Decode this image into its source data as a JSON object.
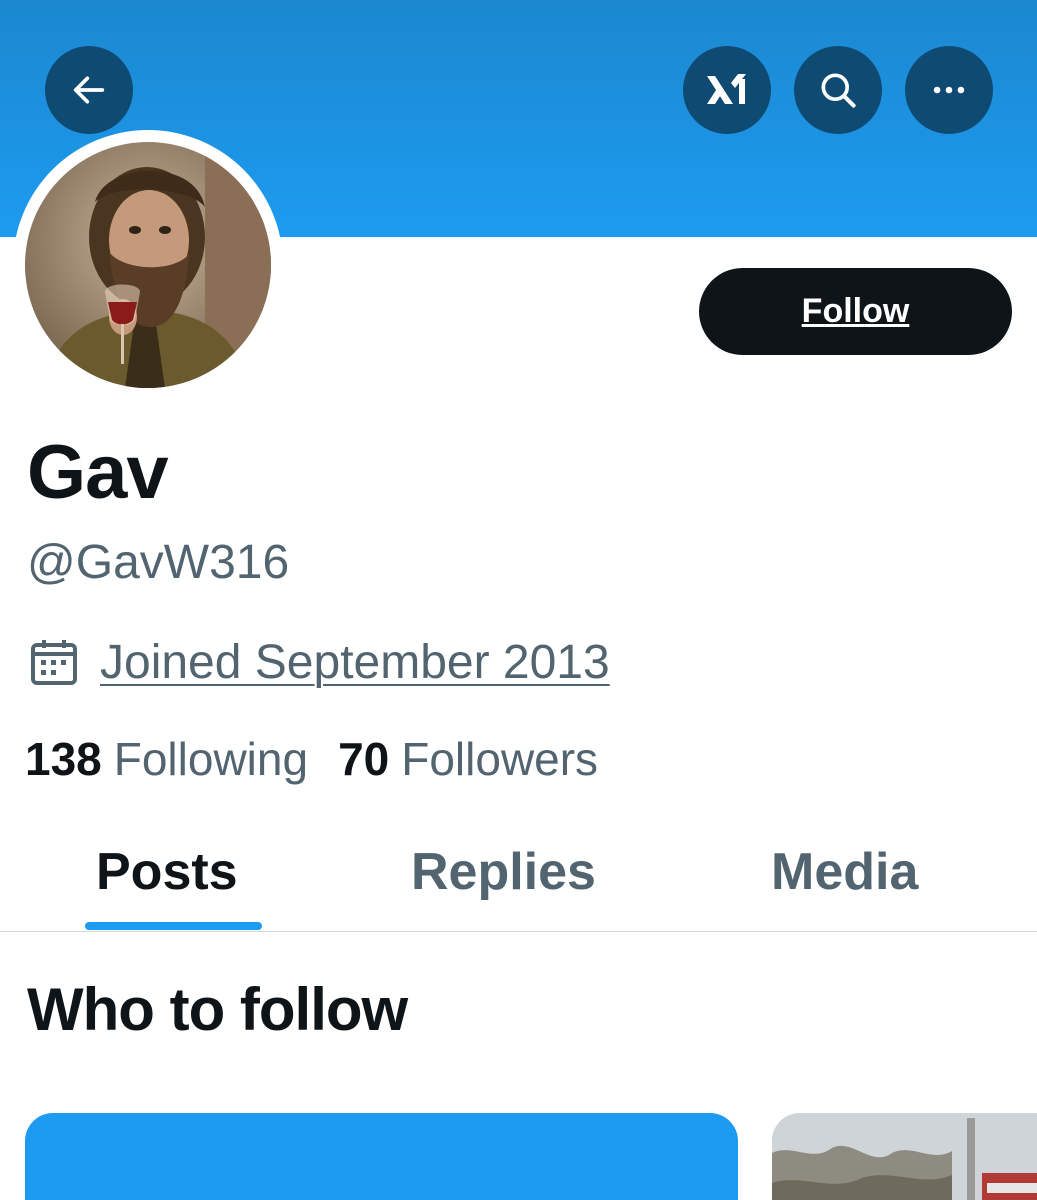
{
  "profile": {
    "name": "Gav",
    "handle": "@GavW316",
    "joined": "Joined September 2013",
    "following_count": "138",
    "following_label": "Following",
    "followers_count": "70",
    "followers_label": "Followers"
  },
  "actions": {
    "follow_label": "Follow"
  },
  "tabs": [
    {
      "label": "Posts",
      "active": true
    },
    {
      "label": "Replies",
      "active": false
    },
    {
      "label": "Media",
      "active": false
    }
  ],
  "sections": {
    "who_to_follow": "Who to follow"
  },
  "icons": {
    "back": "arrow-left-icon",
    "xai": "xai-logo-icon",
    "search": "search-icon",
    "more": "more-horizontal-icon",
    "calendar": "calendar-icon"
  },
  "colors": {
    "accent": "#1d9bf0",
    "banner_button": "#0f4a72",
    "text_primary": "#0f1419",
    "text_secondary": "#536471",
    "follow_button": "#0f1419"
  }
}
